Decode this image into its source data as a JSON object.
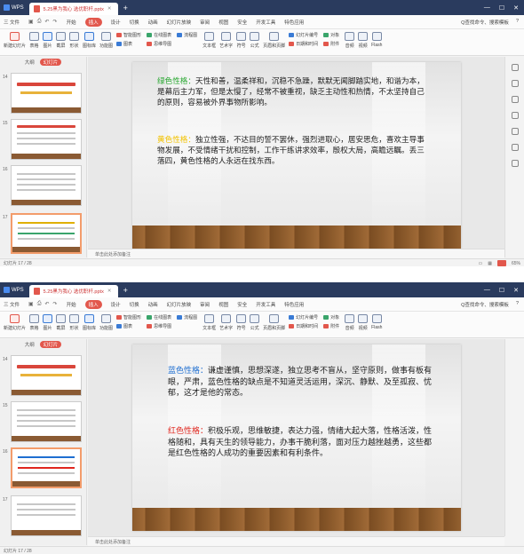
{
  "app": {
    "name": "WPS",
    "file_tab": "5.25黑为我心 选优职杆.pptx"
  },
  "menu": {
    "file": "三 文件",
    "items": [
      "开始",
      "插入",
      "设计",
      "切换",
      "动画",
      "幻灯片放映",
      "审阅",
      "视图",
      "安全",
      "开发工具",
      "特色应用"
    ],
    "active": "插入",
    "search": "Q查找命令、搜索模板",
    "help": "?"
  },
  "toolbar": {
    "items": [
      "新建幻灯片",
      "表格",
      "图片",
      "截屏",
      "形状",
      "图标库",
      "功能图",
      "智能图形",
      "在线图表",
      "流程图",
      "思维导图",
      "文本框",
      "艺术字",
      "符号",
      "公式",
      "页眉和页脚",
      "幻灯片编号",
      "对象",
      "日期和时间",
      "附件",
      "音频",
      "视频",
      "Flash"
    ],
    "col1": [
      "智能图形",
      "图表"
    ],
    "col2": [
      "在线图表",
      "思维导图"
    ],
    "col3": [
      "流程图"
    ]
  },
  "panel": {
    "tab_outline": "大纲",
    "tab_slides": "幻灯片",
    "thumb_title": "高考成绩报告",
    "thumb_subtitle": "一仓主考一仓主考来"
  },
  "w1": {
    "slide_numbers": [
      "14",
      "15",
      "16",
      "17"
    ],
    "green_label": "绿色性格：",
    "green_text": "天性和善，温柔祥和，沉稳不急躁，默默无闻脚踏实地，和谐为本，是幕后主力军，但是太慢了，经常不被重视，缺乏主动性和热情，不太坚持自己的原则，容易被外界事物所影响。",
    "yellow_label": "黄色性格：",
    "yellow_text": "独立性强，不达目的誓不罢休，强烈进取心，居安思危，喜欢主导事物发展，不受情绪干扰和控制，工作干练讲求效率，殷权大局，高瞻远瞩。丢三落四，黄色性格的人永远在找东西。",
    "notes": "单击此处添加备注",
    "status_left": "幻灯片 17 / 28",
    "zoom": "65%"
  },
  "w2": {
    "slide_numbers": [
      "14",
      "15",
      "16",
      "17"
    ],
    "blue_label": "蓝色性格：",
    "blue_text": "谦虚谨慎，思想深遂，独立思考不盲从，坚守原则，做事有板有眼，严肃，蓝色性格的缺点是不知道灵活运用，深沉、静默、及至孤寂、忧郁，这才是他的常态。",
    "red_label": "红色性格：",
    "red_text": "积极乐观，思维敏捷，表达力强，情绪大起大落，性格活泼，性格随和，具有天生的领导能力，办事干脆利落，面对压力越挫越勇，这些都是红色性格的人成功的重要因素和有利条件。",
    "notes": "单击此处添加备注",
    "status_left": "幻灯片 17 / 28"
  },
  "colors": {
    "green": "#2aa832",
    "yellow": "#f2c200",
    "blue": "#1f6fd1",
    "red": "#e0261e",
    "accent": "#e2574c",
    "titlebar": "#2a3b5e"
  }
}
